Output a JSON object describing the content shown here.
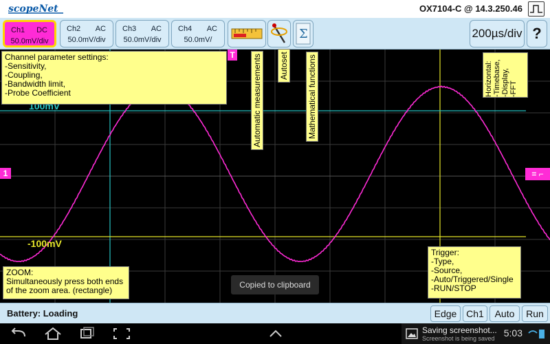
{
  "title_bar": {
    "logo_text": "scopeNet",
    "device": "OX7104-C @ 14.3.250.46"
  },
  "channels": [
    {
      "name": "Ch1",
      "coupling": "DC",
      "scale": "50.0mV/div",
      "active": true
    },
    {
      "name": "Ch2",
      "coupling": "AC",
      "scale": "50.0mV/div",
      "active": false
    },
    {
      "name": "Ch3",
      "coupling": "AC",
      "scale": "50.0mV/div",
      "active": false
    },
    {
      "name": "Ch4",
      "coupling": "AC",
      "scale": "50.0mV/",
      "active": false
    }
  ],
  "toolbar": {
    "timebase": "200µs/div",
    "help": "?",
    "icons": [
      "measurement-ruler-icon",
      "autoset-probe-icon",
      "math-sigma-icon"
    ]
  },
  "markers": {
    "channel_ref": "1",
    "trigger_pos": "T",
    "trigger_level": "=",
    "upper_level": "100mV",
    "lower_level": "-100mV"
  },
  "tooltips": {
    "channel_settings": [
      "Channel parameter settings:",
      " -Sensitivity,",
      " -Coupling,",
      " -Bandwidth limit,",
      " -Probe Coefficient"
    ],
    "automatic_measurements": "Automatic measurements",
    "autoset": "Autoset",
    "math_functions": "Mathematical functions",
    "horizontal": [
      "Horizontal:",
      " -Timebase,",
      " -Display,",
      " -FFT"
    ],
    "zoom": [
      "ZOOM:",
      "Simultaneously press both ends",
      "of the zoom area. (rectangle)"
    ],
    "trigger": [
      "Trigger:",
      " -Type,",
      " -Source,",
      " -Auto/Triggered/Single",
      " -RUN/STOP"
    ]
  },
  "toast": "Copied to clipboard",
  "bottom_bar": {
    "battery": "Battery: Loading",
    "buttons": [
      "Edge",
      "Ch1",
      "Auto",
      "Run"
    ]
  },
  "notification": {
    "title": "Saving screenshot...",
    "subtitle": "Screenshot is being saved",
    "clock": "5:03"
  },
  "colors": {
    "trace": "#ff2bd6",
    "cursor_upper": "#27c4c4",
    "cursor_lower": "#e6e62a",
    "tooltip_bg": "#ffff8c",
    "toolbar_bg": "#cfe7f5"
  }
}
